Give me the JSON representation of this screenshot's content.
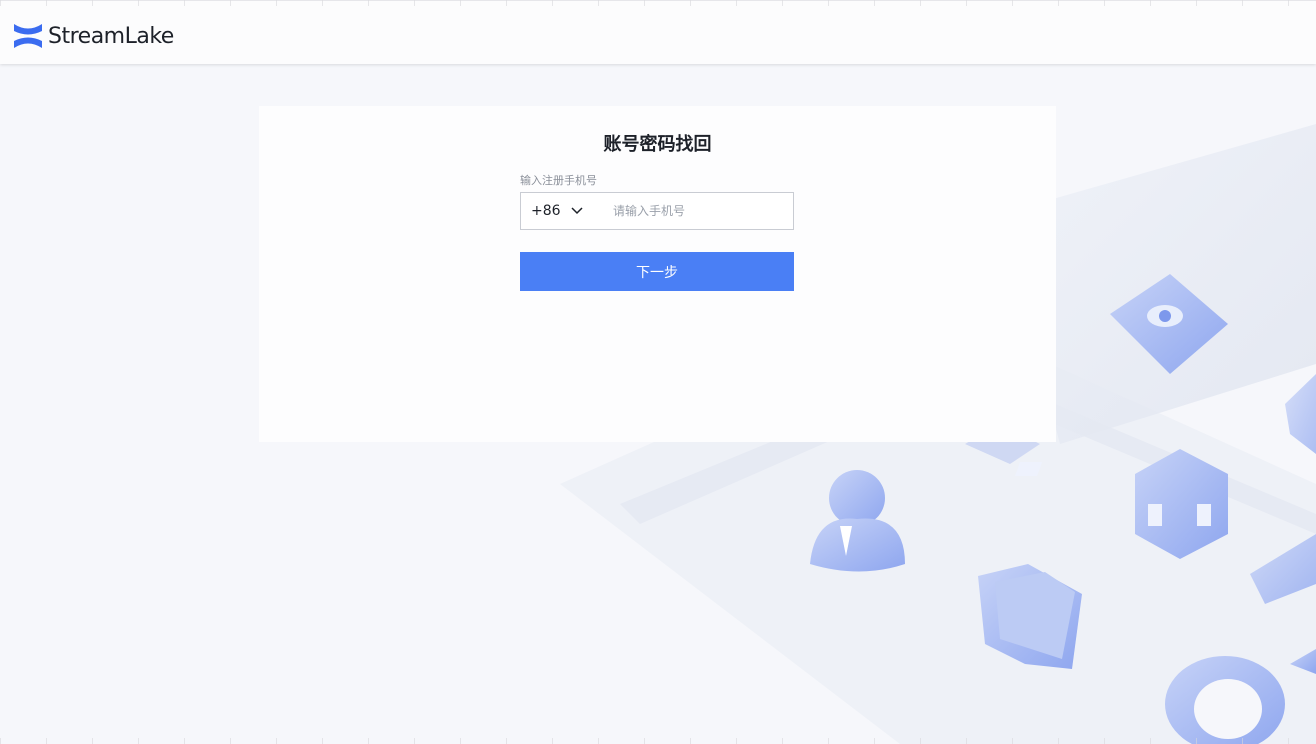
{
  "brand": {
    "name": "StreamLake"
  },
  "page": {
    "title": "账号密码找回"
  },
  "form": {
    "phone_label": "输入注册手机号",
    "country_code": "+86",
    "phone_placeholder": "请输入手机号",
    "phone_value": "",
    "next_label": "下一步"
  },
  "colors": {
    "accent": "#4a7ff5",
    "logo": "#3b6cf0"
  }
}
